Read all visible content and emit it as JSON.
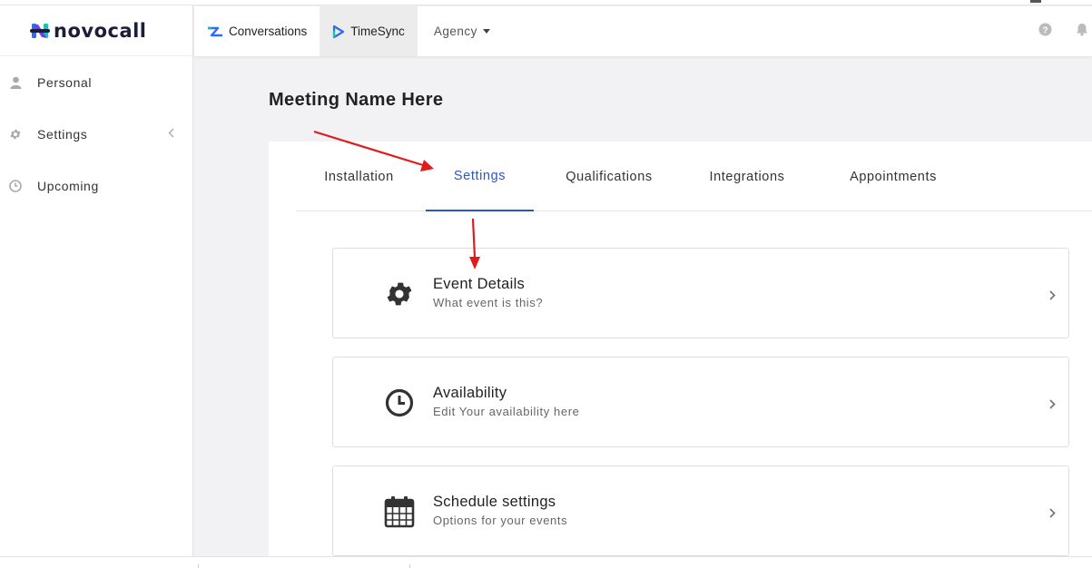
{
  "brand": {
    "logo_text": "novocall"
  },
  "sidebar": {
    "items": [
      {
        "label": "Personal",
        "icon": "user-icon"
      },
      {
        "label": "Settings",
        "icon": "gear-icon",
        "chevron": "chevron-left-icon"
      },
      {
        "label": "Upcoming",
        "icon": "clock-icon"
      }
    ]
  },
  "topbar": {
    "items": [
      {
        "label": "Conversations",
        "icon": "conversations-logo-icon"
      },
      {
        "label": "TimeSync",
        "icon": "timesync-logo-icon",
        "active": true
      },
      {
        "label": "Agency",
        "icon": "caret-down-icon"
      }
    ],
    "right_icons": [
      "help-icon",
      "bell-icon"
    ]
  },
  "page": {
    "title": "Meeting Name Here"
  },
  "tabs": [
    {
      "label": "Installation"
    },
    {
      "label": "Settings",
      "active": true
    },
    {
      "label": "Qualifications"
    },
    {
      "label": "Integrations"
    },
    {
      "label": "Appointments"
    }
  ],
  "cards": [
    {
      "title": "Event Details",
      "subtitle": "What event is this?",
      "icon": "gear-icon"
    },
    {
      "title": "Availability",
      "subtitle": "Edit Your availability here",
      "icon": "clock-icon"
    },
    {
      "title": "Schedule settings",
      "subtitle": "Options for your events",
      "icon": "calendar-icon"
    }
  ],
  "colors": {
    "accent": "#2a56c4",
    "annotation_arrow": "#e01b1b",
    "logo_teal": "#17c3b2",
    "logo_blue": "#2d6cf6",
    "logo_purple": "#6a3df0"
  }
}
